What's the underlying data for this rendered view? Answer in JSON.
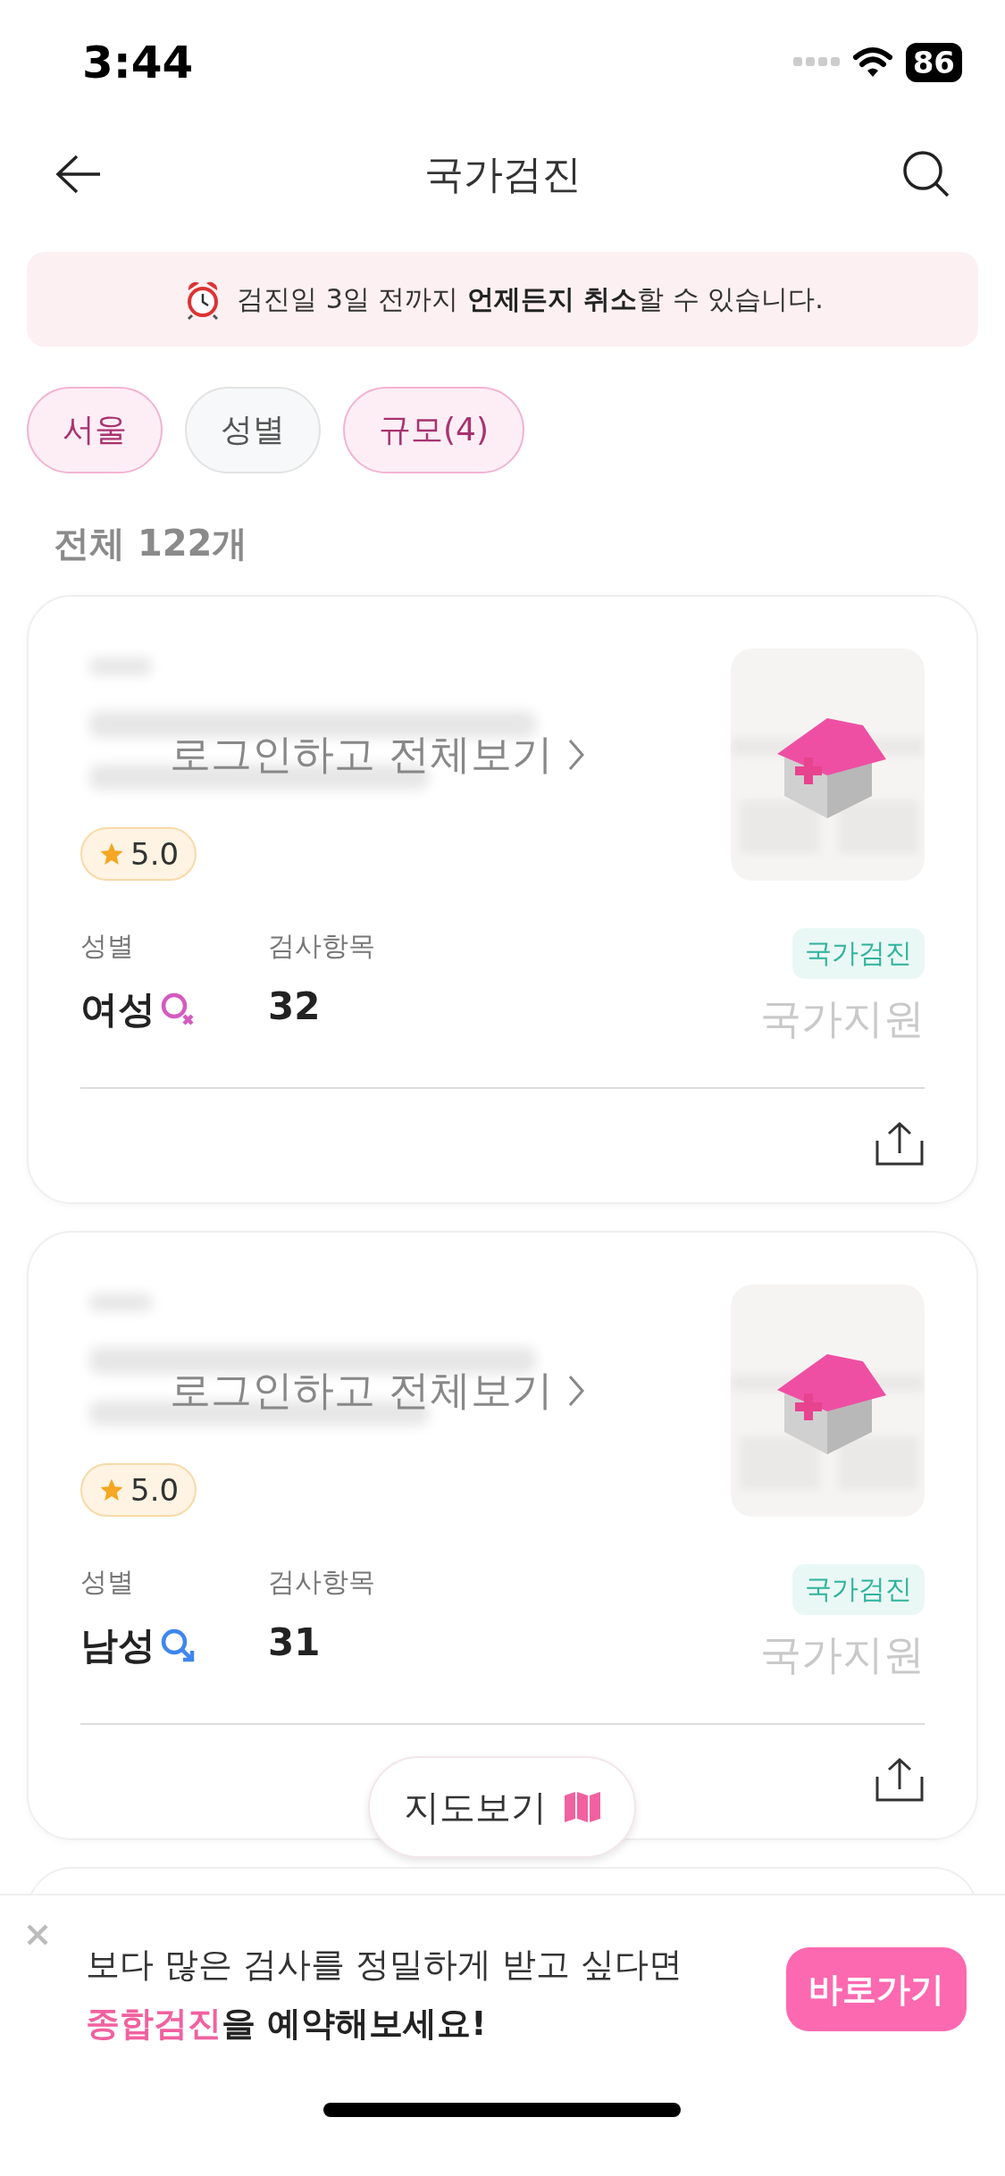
{
  "status_bar": {
    "time": "3:44",
    "battery": "86"
  },
  "nav": {
    "title": "국가검진"
  },
  "notice": {
    "text": "검진일 3일 전까지 **언제든지 취소**할 수 있습니다."
  },
  "filters": [
    {
      "label": "서울",
      "selected": true
    },
    {
      "label": "성별",
      "selected": false
    },
    {
      "label": "규모(4)",
      "selected": true
    }
  ],
  "total": "전체 122개",
  "cards": [
    {
      "login_link": "로그인하고 전체보기",
      "rating": "5.0",
      "gender_label": "성별",
      "gender": "여성",
      "kind": "female",
      "items_label": "검사항목",
      "items": "32",
      "tag": "국가검진",
      "support": "국가지원"
    },
    {
      "login_link": "로그인하고 전체보기",
      "rating": "5.0",
      "gender_label": "성별",
      "gender": "남성",
      "kind": "male",
      "items_label": "검사항목",
      "items": "31",
      "tag": "국가검진",
      "support": "국가지원"
    }
  ],
  "map_button": "지도보기",
  "promo": {
    "line1": "보다 많은 검사를 정밀하게 받고 싶다면",
    "line2": "**종합검진**을 예약해보세요!",
    "button": "바로가기"
  }
}
